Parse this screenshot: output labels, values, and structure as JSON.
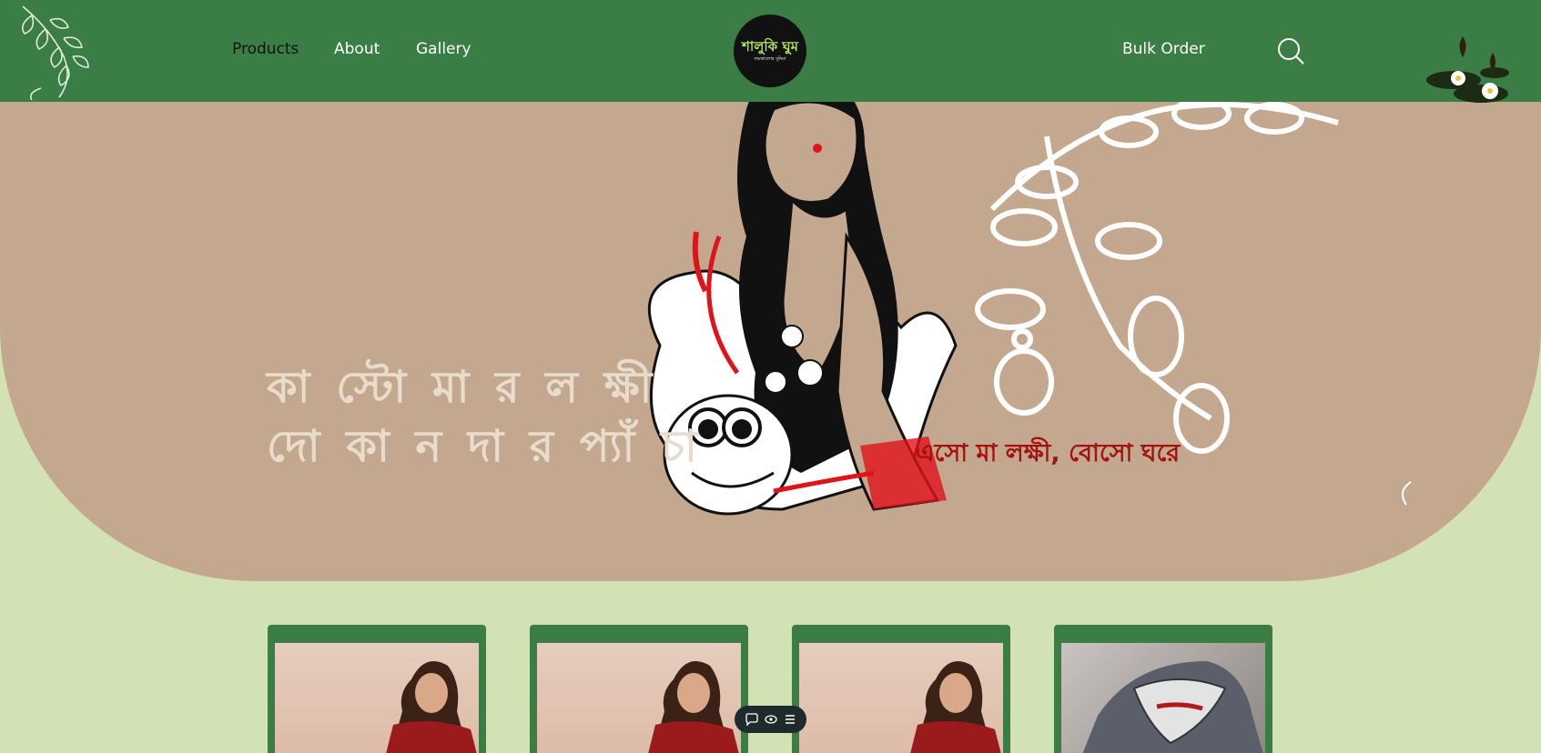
{
  "header": {
    "nav_left": [
      "Products",
      "About",
      "Gallery"
    ],
    "nav_right": "Bulk Order",
    "logo_main": "শালুকি ঘুম",
    "logo_sub": "জমকালোর দুনিয়া"
  },
  "hero": {
    "title_line1": "কা স্টো মা র ল ক্ষী",
    "title_line2": "দো কা ন দা র প্যাঁ চা",
    "tagline": "এসো মা লক্ষী, বোসো ঘরে"
  },
  "colors": {
    "header_bg": "#3b7e45",
    "page_bg": "#d3e2b5",
    "hero_bg": "#c3a78e",
    "tagline": "#a5110e"
  },
  "products": [
    {
      "image": "woman-red-dress"
    },
    {
      "image": "woman-red-dress"
    },
    {
      "image": "woman-red-dress"
    },
    {
      "image": "checked-shirt-collar"
    }
  ],
  "floating_toolbar": {
    "icons": [
      "chat-icon",
      "eye-icon",
      "menu-icon"
    ]
  }
}
